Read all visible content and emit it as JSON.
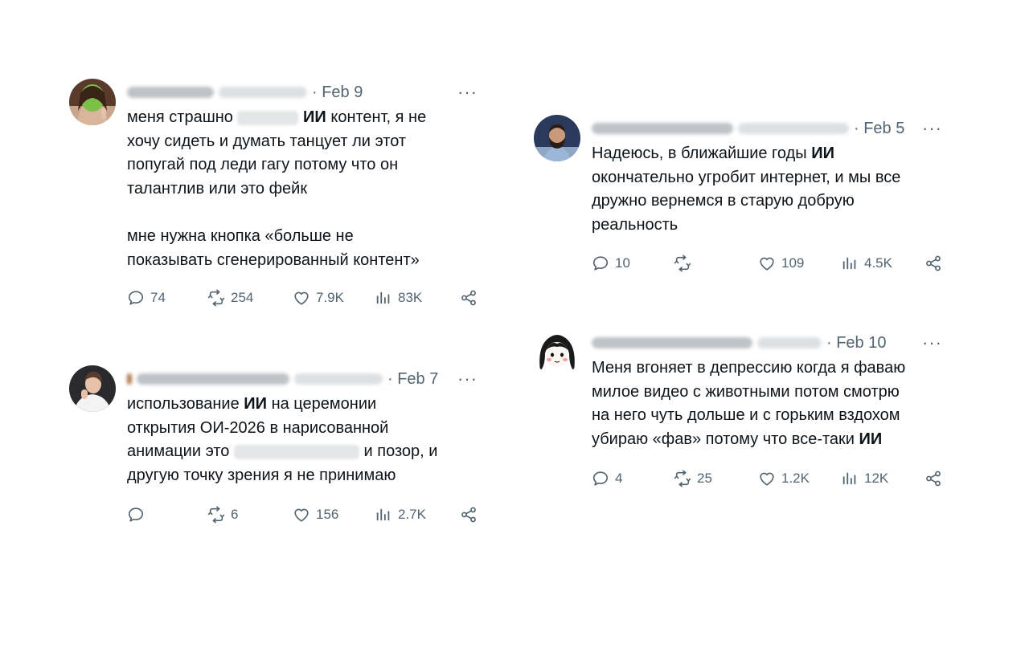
{
  "tweets": [
    {
      "date": "· Feb 9",
      "more": "···",
      "avatar": "alien-mask-avatar",
      "lines": [
        [
          "меня страшно ",
          "[redacted]",
          "ИИ",
          " контент, я не"
        ],
        "хочу сидеть и думать танцует ли этот",
        "попугай под леди гагу потому что он",
        "талантлив или это фейк",
        "",
        "мне нужна кнопка «больше не",
        "показывать сгенерированный контент»"
      ],
      "stats": {
        "replies": "74",
        "reposts": "254",
        "likes": "7.9K",
        "views": "83K"
      }
    },
    {
      "date": "· Feb 7",
      "more": "···",
      "avatar": "person-selfie-avatar",
      "lines": [
        [
          "использование ",
          "ИИ",
          " на церемонии"
        ],
        "открытия ОИ-2026 в нарисованной",
        [
          "анимации это ",
          "[redacted]",
          " и позор, и"
        ],
        "другую точку зрения я не принимаю"
      ],
      "stats": {
        "replies": "",
        "reposts": "6",
        "likes": "156",
        "views": "2.7K"
      }
    },
    {
      "date": "· Feb 5",
      "more": "···",
      "avatar": "bearded-man-avatar",
      "lines": [
        [
          "Надеюсь, в ближайшие годы ",
          "ИИ"
        ],
        "окончательно угробит интернет, и мы все",
        "дружно вернемся в старую добрую",
        "реальность"
      ],
      "stats": {
        "replies": "10",
        "reposts": "",
        "likes": "109",
        "views": "4.5K"
      }
    },
    {
      "date": "· Feb 10",
      "more": "···",
      "avatar": "cartoon-girl-avatar",
      "lines": [
        "Меня вгоняет в депрессию когда я фаваю",
        "милое видео с животными потом смотрю",
        "на него чуть дольше и с горьким вздохом",
        [
          "убираю «фав» потому что все-таки ",
          "ИИ"
        ]
      ],
      "stats": {
        "replies": "4",
        "reposts": "25",
        "likes": "1.2K",
        "views": "12K"
      }
    }
  ],
  "icons": {
    "reply": "reply-icon",
    "repost": "repost-icon",
    "like": "like-icon",
    "views": "views-icon",
    "share": "share-icon",
    "more": "more-options-icon"
  },
  "colors": {
    "text": "#0f1419",
    "secondary": "#536471",
    "background": "#ffffff"
  }
}
